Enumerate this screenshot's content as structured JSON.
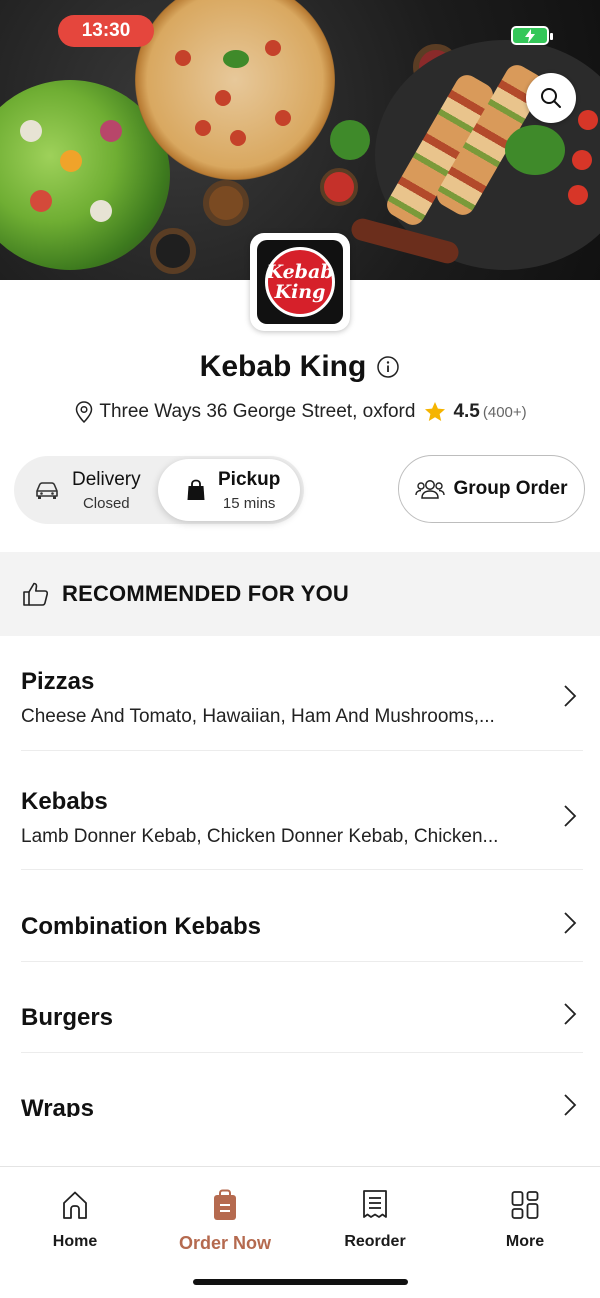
{
  "status_bar": {
    "time": "13:30"
  },
  "restaurant": {
    "logo_text": [
      "Kebab",
      "King"
    ],
    "name": "Kebab King",
    "address": "Three Ways 36 George Street, oxford",
    "rating": "4.5",
    "rating_count": "(400+)"
  },
  "order_mode": {
    "delivery": {
      "label": "Delivery",
      "status": "Closed"
    },
    "pickup": {
      "label": "Pickup",
      "status": "15 mins"
    },
    "selected": "pickup"
  },
  "group_order": {
    "label": "Group Order"
  },
  "recommended": {
    "title": "RECOMMENDED FOR YOU"
  },
  "categories": [
    {
      "name": "Pizzas",
      "description": "Cheese And Tomato, Hawaiian, Ham And Mushrooms,..."
    },
    {
      "name": "Kebabs",
      "description": "Lamb Donner Kebab, Chicken Donner Kebab, Chicken..."
    },
    {
      "name": "Combination Kebabs",
      "description": ""
    },
    {
      "name": "Burgers",
      "description": ""
    },
    {
      "name": "Wraps",
      "description": ""
    }
  ],
  "tabs": [
    {
      "label": "Home",
      "icon": "home-icon"
    },
    {
      "label": "Order Now",
      "icon": "order-bag-icon"
    },
    {
      "label": "Reorder",
      "icon": "receipt-icon"
    },
    {
      "label": "More",
      "icon": "grid-icon"
    }
  ],
  "active_tab": "Order Now",
  "colors": {
    "accent": "#b56a4f",
    "time_pill": "#e5463d",
    "battery": "#34c759",
    "star": "#f5b400"
  }
}
